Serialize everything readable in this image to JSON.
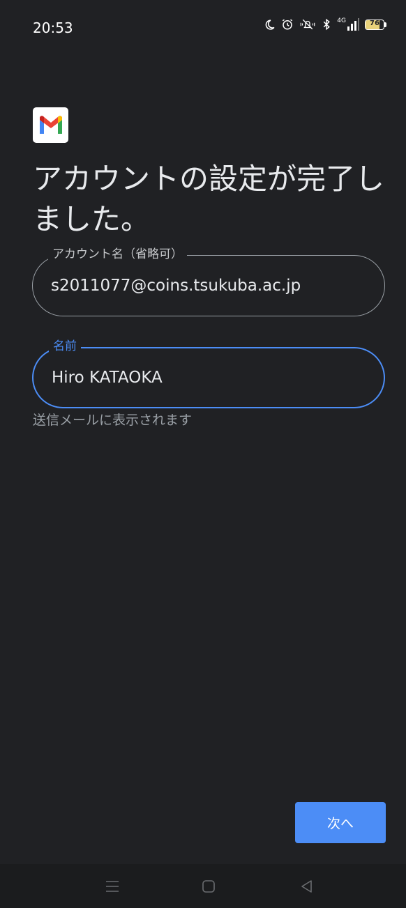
{
  "status_bar": {
    "time": "20:53",
    "network": "4G",
    "battery_level": "76",
    "icons": [
      "moon-icon",
      "alarm-icon",
      "silent-icon",
      "bluetooth-icon",
      "signal-icon",
      "battery-icon"
    ]
  },
  "app": {
    "logo": "gmail-logo"
  },
  "title": "アカウントの設定が完了しました。",
  "account_field": {
    "label": "アカウント名（省略可）",
    "value": "s2011077@coins.tsukuba.ac.jp"
  },
  "name_field": {
    "label": "名前",
    "value": "Hiro KATAOKA",
    "helper": "送信メールに表示されます"
  },
  "next_button": {
    "label": "次へ",
    "color": "#4c8df6"
  },
  "nav_bar": {
    "icons": [
      "menu-icon",
      "home-icon",
      "back-icon"
    ]
  },
  "colors": {
    "background": "#202124",
    "accent": "#4c8df6"
  }
}
